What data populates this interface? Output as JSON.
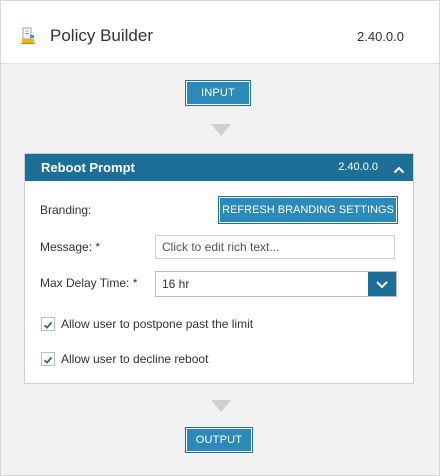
{
  "header": {
    "title": "Policy Builder",
    "version": "2.40.0.0",
    "icon": "policy-builder-icon"
  },
  "flow": {
    "input_label": "INPUT",
    "output_label": "OUTPUT"
  },
  "card": {
    "title": "Reboot Prompt",
    "version": "2.40.0.0",
    "collapse_icon": "chevron-up-icon",
    "accent": "#1e6f98"
  },
  "form": {
    "branding_label": "Branding:",
    "refresh_button": "REFRESH BRANDING SETTINGS",
    "message_label": "Message: *",
    "message_placeholder": "Click to edit rich text...",
    "max_delay_label": "Max Delay Time: *",
    "max_delay_value": "16 hr",
    "postpone_label": "Allow user to postpone past the limit",
    "postpone_checked": true,
    "decline_label": "Allow user to decline reboot",
    "decline_checked": true
  },
  "colors": {
    "button_blue": "#2b8ab9",
    "header_blue": "#1e6f98",
    "panel_bg": "#f2f2f2"
  }
}
